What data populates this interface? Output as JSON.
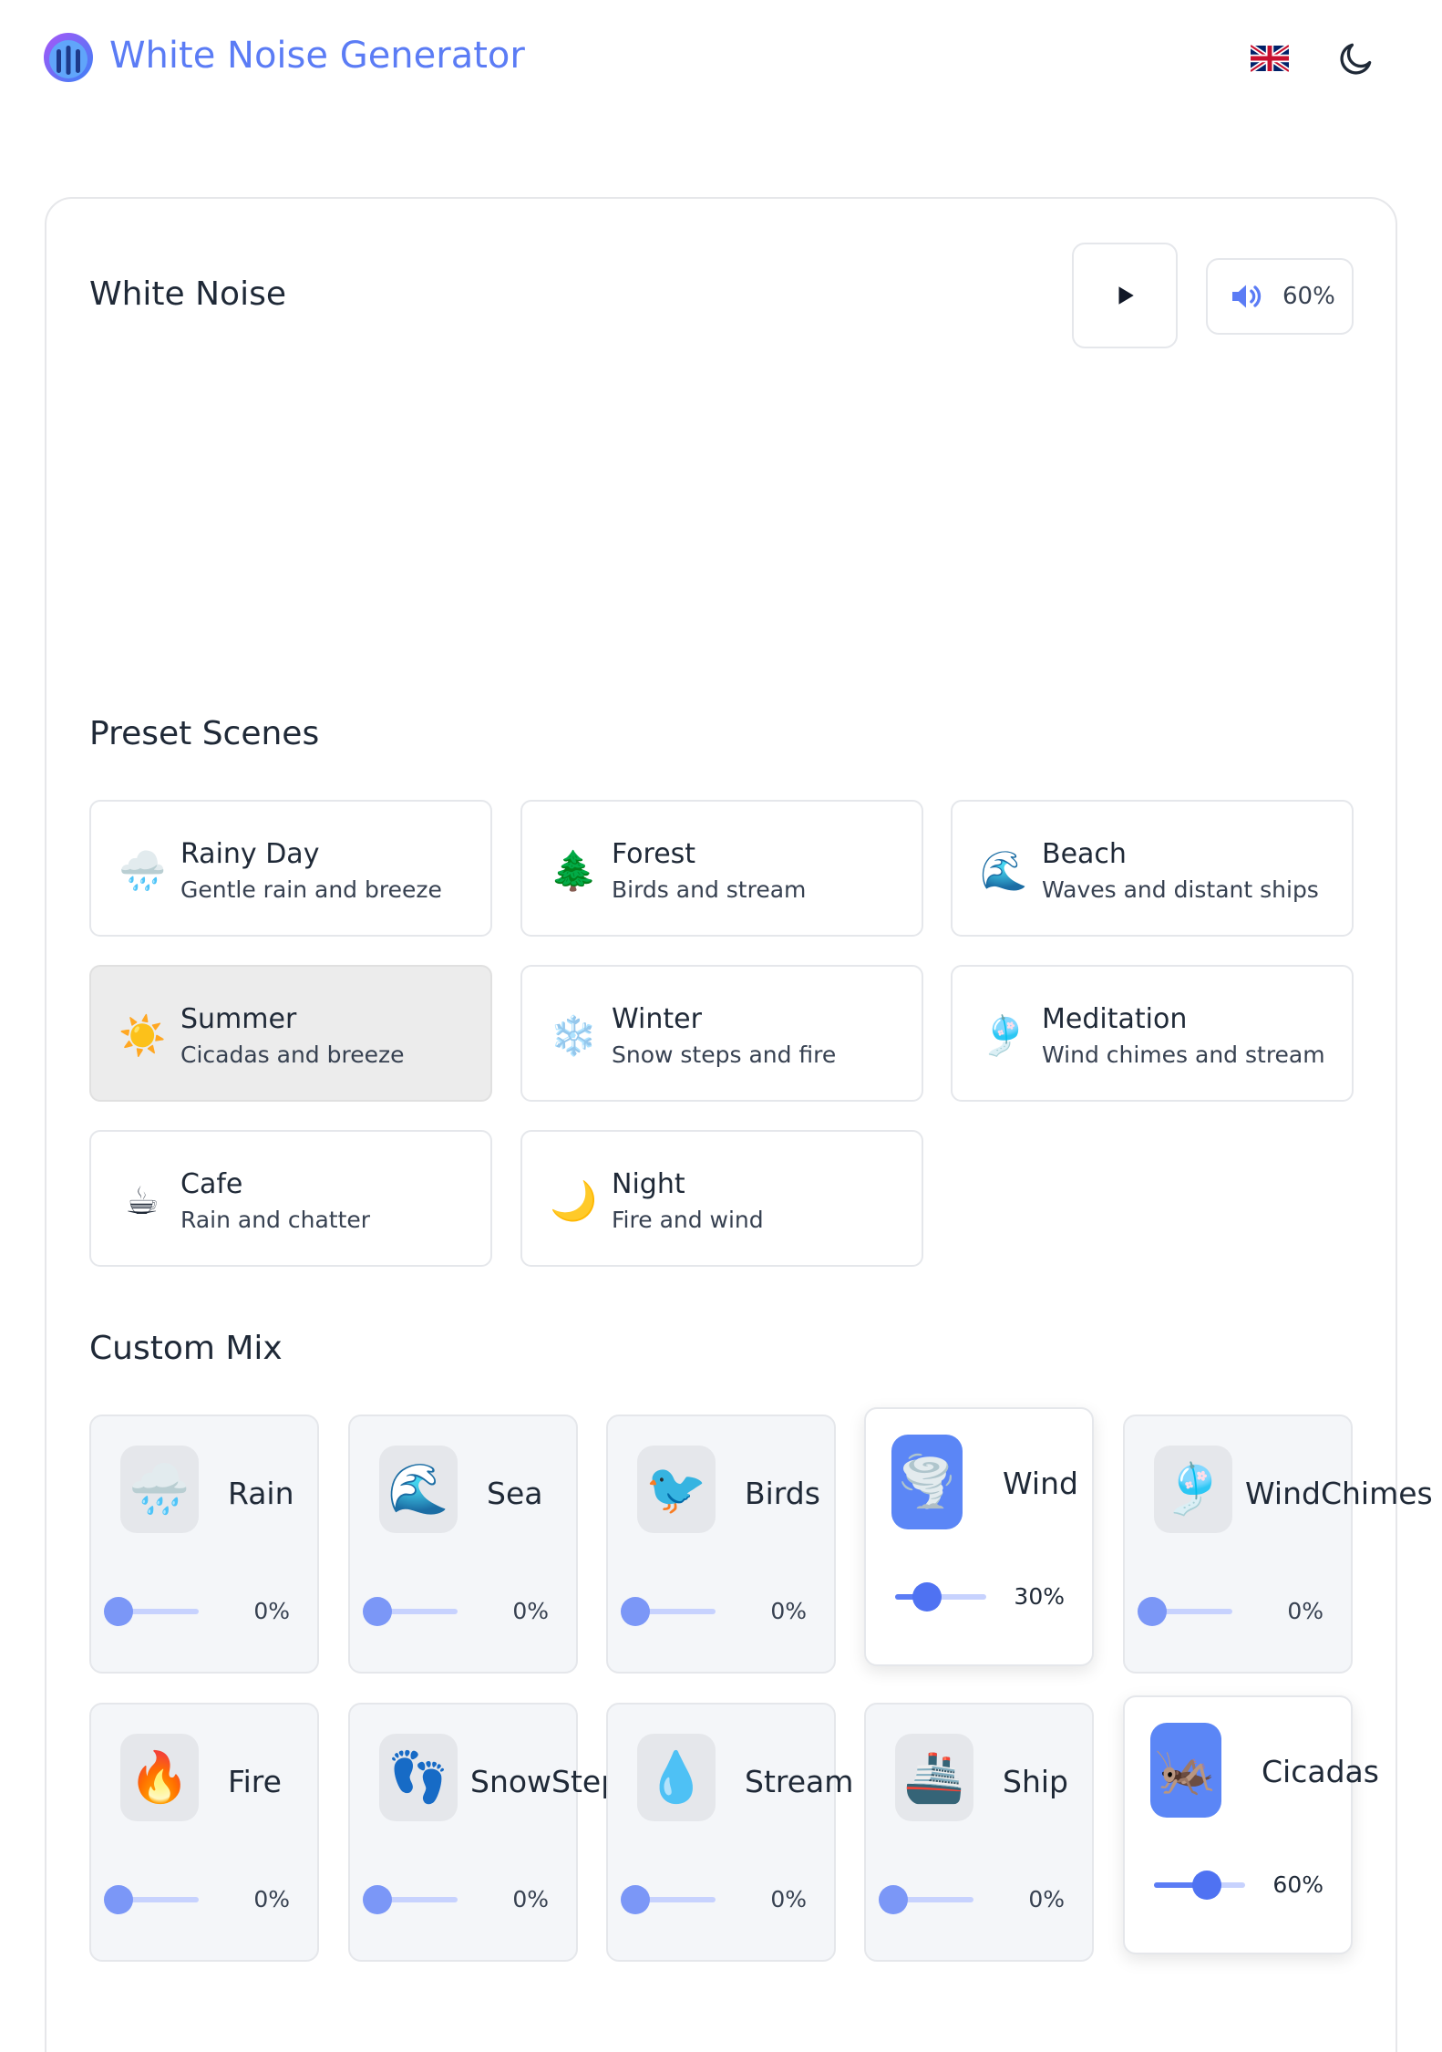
{
  "app": {
    "title": "White Noise Generator"
  },
  "header": {
    "language_icon": "uk-flag-icon",
    "theme_icon": "moon-icon"
  },
  "player": {
    "title": "White Noise",
    "play_icon": "play-icon",
    "volume_icon": "speaker-icon",
    "volume": "60%",
    "volume_level": 0.6
  },
  "presets": {
    "title": "Preset Scenes",
    "items": [
      {
        "icon": "🌧️",
        "icon_name": "rain-cloud-icon",
        "name": "Rainy Day",
        "desc": "Gentle rain and breeze"
      },
      {
        "icon": "🌲",
        "icon_name": "tree-icon",
        "name": "Forest",
        "desc": "Birds and stream"
      },
      {
        "icon": "🌊",
        "icon_name": "wave-icon",
        "name": "Beach",
        "desc": "Waves and distant ships"
      },
      {
        "icon": "☀️",
        "icon_name": "sun-icon",
        "name": "Summer",
        "desc": "Cicadas and breeze",
        "active": true
      },
      {
        "icon": "❄️",
        "icon_name": "snowflake-icon",
        "name": "Winter",
        "desc": "Snow steps and fire"
      },
      {
        "icon": "🎐",
        "icon_name": "wind-chime-icon",
        "name": "Meditation",
        "desc": "Wind chimes and stream"
      },
      {
        "icon": "☕",
        "icon_name": "coffee-icon",
        "name": "Cafe",
        "desc": "Rain and chatter"
      },
      {
        "icon": "🌙",
        "icon_name": "crescent-moon-icon",
        "name": "Night",
        "desc": "Fire and wind"
      }
    ]
  },
  "mix": {
    "title": "Custom Mix",
    "sounds": [
      {
        "icon": "🌧️",
        "icon_name": "rain-cloud-icon",
        "name": "Rain",
        "value": "0%",
        "level": 0
      },
      {
        "icon": "🌊",
        "icon_name": "wave-icon",
        "name": "Sea",
        "value": "0%",
        "level": 0
      },
      {
        "icon": "🐦",
        "icon_name": "bird-icon",
        "name": "Birds",
        "value": "0%",
        "level": 0
      },
      {
        "icon": "🌪️",
        "icon_name": "tornado-icon",
        "name": "Wind",
        "value": "30%",
        "level": 0.3,
        "active": true
      },
      {
        "icon": "🎐",
        "icon_name": "wind-chime-icon",
        "name": "Wind Chimes",
        "value": "0%",
        "level": 0
      },
      {
        "icon": "🔥",
        "icon_name": "fire-icon",
        "name": "Fire",
        "value": "0%",
        "level": 0
      },
      {
        "icon": "👣",
        "icon_name": "footprints-icon",
        "name": "Snow Steps",
        "value": "0%",
        "level": 0
      },
      {
        "icon": "💧",
        "icon_name": "droplet-icon",
        "name": "Stream",
        "value": "0%",
        "level": 0
      },
      {
        "icon": "🚢",
        "icon_name": "ship-icon",
        "name": "Ship",
        "value": "0%",
        "level": 0
      },
      {
        "icon": "🦗",
        "icon_name": "cricket-icon",
        "name": "Cicadas",
        "value": "60%",
        "level": 0.6,
        "active": true
      }
    ]
  },
  "colors": {
    "accent": "#5b7cf5",
    "active_icon_bg": "#5b86f6",
    "tile_bg": "#f4f6f9",
    "active_preset_bg": "#ececec"
  }
}
